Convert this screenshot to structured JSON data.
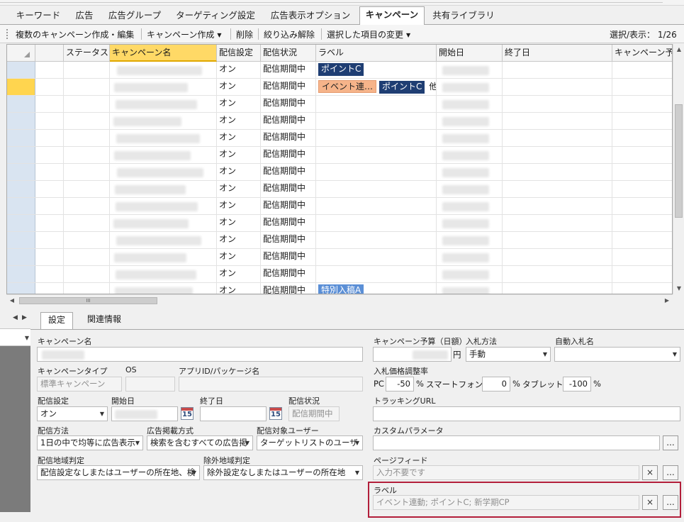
{
  "tabs": [
    {
      "label": "キーワード",
      "active": false
    },
    {
      "label": "広告",
      "active": false
    },
    {
      "label": "広告グループ",
      "active": false
    },
    {
      "label": "ターゲティング設定",
      "active": false
    },
    {
      "label": "広告表示オプション",
      "active": false
    },
    {
      "label": "キャンペーン",
      "active": true
    },
    {
      "label": "共有ライブラリ",
      "active": false
    }
  ],
  "toolbar": {
    "bulk_create_edit": "複数のキャンペーン作成・編集",
    "create_campaign": "キャンペーン作成",
    "delete": "削除",
    "clear_filter": "絞り込み解除",
    "change_selected": "選択した項目の変更",
    "selection_count": "選択/表示： 1/26"
  },
  "grid": {
    "columns": {
      "status": "ステータス",
      "campaign_name": "キャンペーン名",
      "delivery_setting": "配信設定",
      "delivery_state": "配信状況",
      "label": "ラベル",
      "start_date": "開始日",
      "end_date": "終了日",
      "campaign_budget": "キャンペーン予"
    },
    "rows": [
      {
        "setting": "オン",
        "state": "配信期間中",
        "labels": [
          {
            "text": "ポイントC",
            "style": "blue"
          }
        ],
        "more": ""
      },
      {
        "setting": "オン",
        "state": "配信期間中",
        "labels": [
          {
            "text": "イベント連…",
            "style": "orange"
          },
          {
            "text": "ポイントC",
            "style": "blue"
          }
        ],
        "more": "他"
      },
      {
        "setting": "オン",
        "state": "配信期間中",
        "labels": [],
        "more": ""
      },
      {
        "setting": "オン",
        "state": "配信期間中",
        "labels": [],
        "more": ""
      },
      {
        "setting": "オン",
        "state": "配信期間中",
        "labels": [],
        "more": ""
      },
      {
        "setting": "オン",
        "state": "配信期間中",
        "labels": [],
        "more": ""
      },
      {
        "setting": "オン",
        "state": "配信期間中",
        "labels": [],
        "more": ""
      },
      {
        "setting": "オン",
        "state": "配信期間中",
        "labels": [],
        "more": ""
      },
      {
        "setting": "オン",
        "state": "配信期間中",
        "labels": [],
        "more": ""
      },
      {
        "setting": "オン",
        "state": "配信期間中",
        "labels": [],
        "more": ""
      },
      {
        "setting": "オン",
        "state": "配信期間中",
        "labels": [],
        "more": ""
      },
      {
        "setting": "オン",
        "state": "配信期間中",
        "labels": [],
        "more": ""
      },
      {
        "setting": "オン",
        "state": "配信期間中",
        "labels": [],
        "more": ""
      },
      {
        "setting": "オン",
        "state": "配信期間中",
        "labels": [
          {
            "text": "特別入稿A",
            "style": "light"
          }
        ],
        "more": ""
      }
    ]
  },
  "scrollbar_thumb_glyph": "III",
  "detail_tabs": {
    "settings": "設定",
    "related": "関連情報"
  },
  "form": {
    "campaign_name_label": "キャンペーン名",
    "campaign_type_label": "キャンペーンタイプ",
    "campaign_type_value": "標準キャンペーン",
    "os_label": "OS",
    "app_id_label": "アプリID/パッケージ名",
    "delivery_setting_label": "配信設定",
    "delivery_setting_value": "オン",
    "start_date_label": "開始日",
    "end_date_label": "終了日",
    "delivery_state_label": "配信状況",
    "delivery_state_value": "配信期間中",
    "calendar_day": "15",
    "delivery_method_label": "配信方法",
    "delivery_method_value": "1日の中で均等に広告表示",
    "ad_placement_label": "広告掲載方式",
    "ad_placement_value": "検索を含むすべての広告掲",
    "target_users_label": "配信対象ユーザー",
    "target_users_value": "ターゲットリストのユーザ",
    "geo_label": "配信地域判定",
    "geo_value": "配信設定なしまたはユーザーの所在地、検",
    "exclude_geo_label": "除外地域判定",
    "exclude_geo_value": "除外設定なしまたはユーザーの所在地",
    "daily_budget_label": "キャンペーン予算（日額）",
    "yen": "円",
    "bid_method_label": "入札方法",
    "bid_method_value": "手動",
    "auto_bid_label": "自動入札名",
    "bid_adjust_label": "入札価格調整率",
    "pc_label": "PC",
    "pc_value": "-50",
    "smartphone_label": "スマートフォン",
    "smartphone_value": "0",
    "tablet_label": "タブレット",
    "tablet_value": "-100",
    "percent": "%",
    "tracking_url_label": "トラッキングURL",
    "custom_param_label": "カスタムパラメータ",
    "page_feed_label": "ページフィード",
    "page_feed_value": "入力不要です",
    "label_field_label": "ラベル",
    "label_field_value": "イベント連動; ポイントC; 新学期CP",
    "ellipsis": "...",
    "clear": "×"
  },
  "colors": {
    "label_blue": "#1f3e73",
    "label_orange": "#f6b48a",
    "label_light_blue": "#5b8fd6",
    "selected_header": "#ffd966",
    "highlight_border": "#b21e3a"
  }
}
